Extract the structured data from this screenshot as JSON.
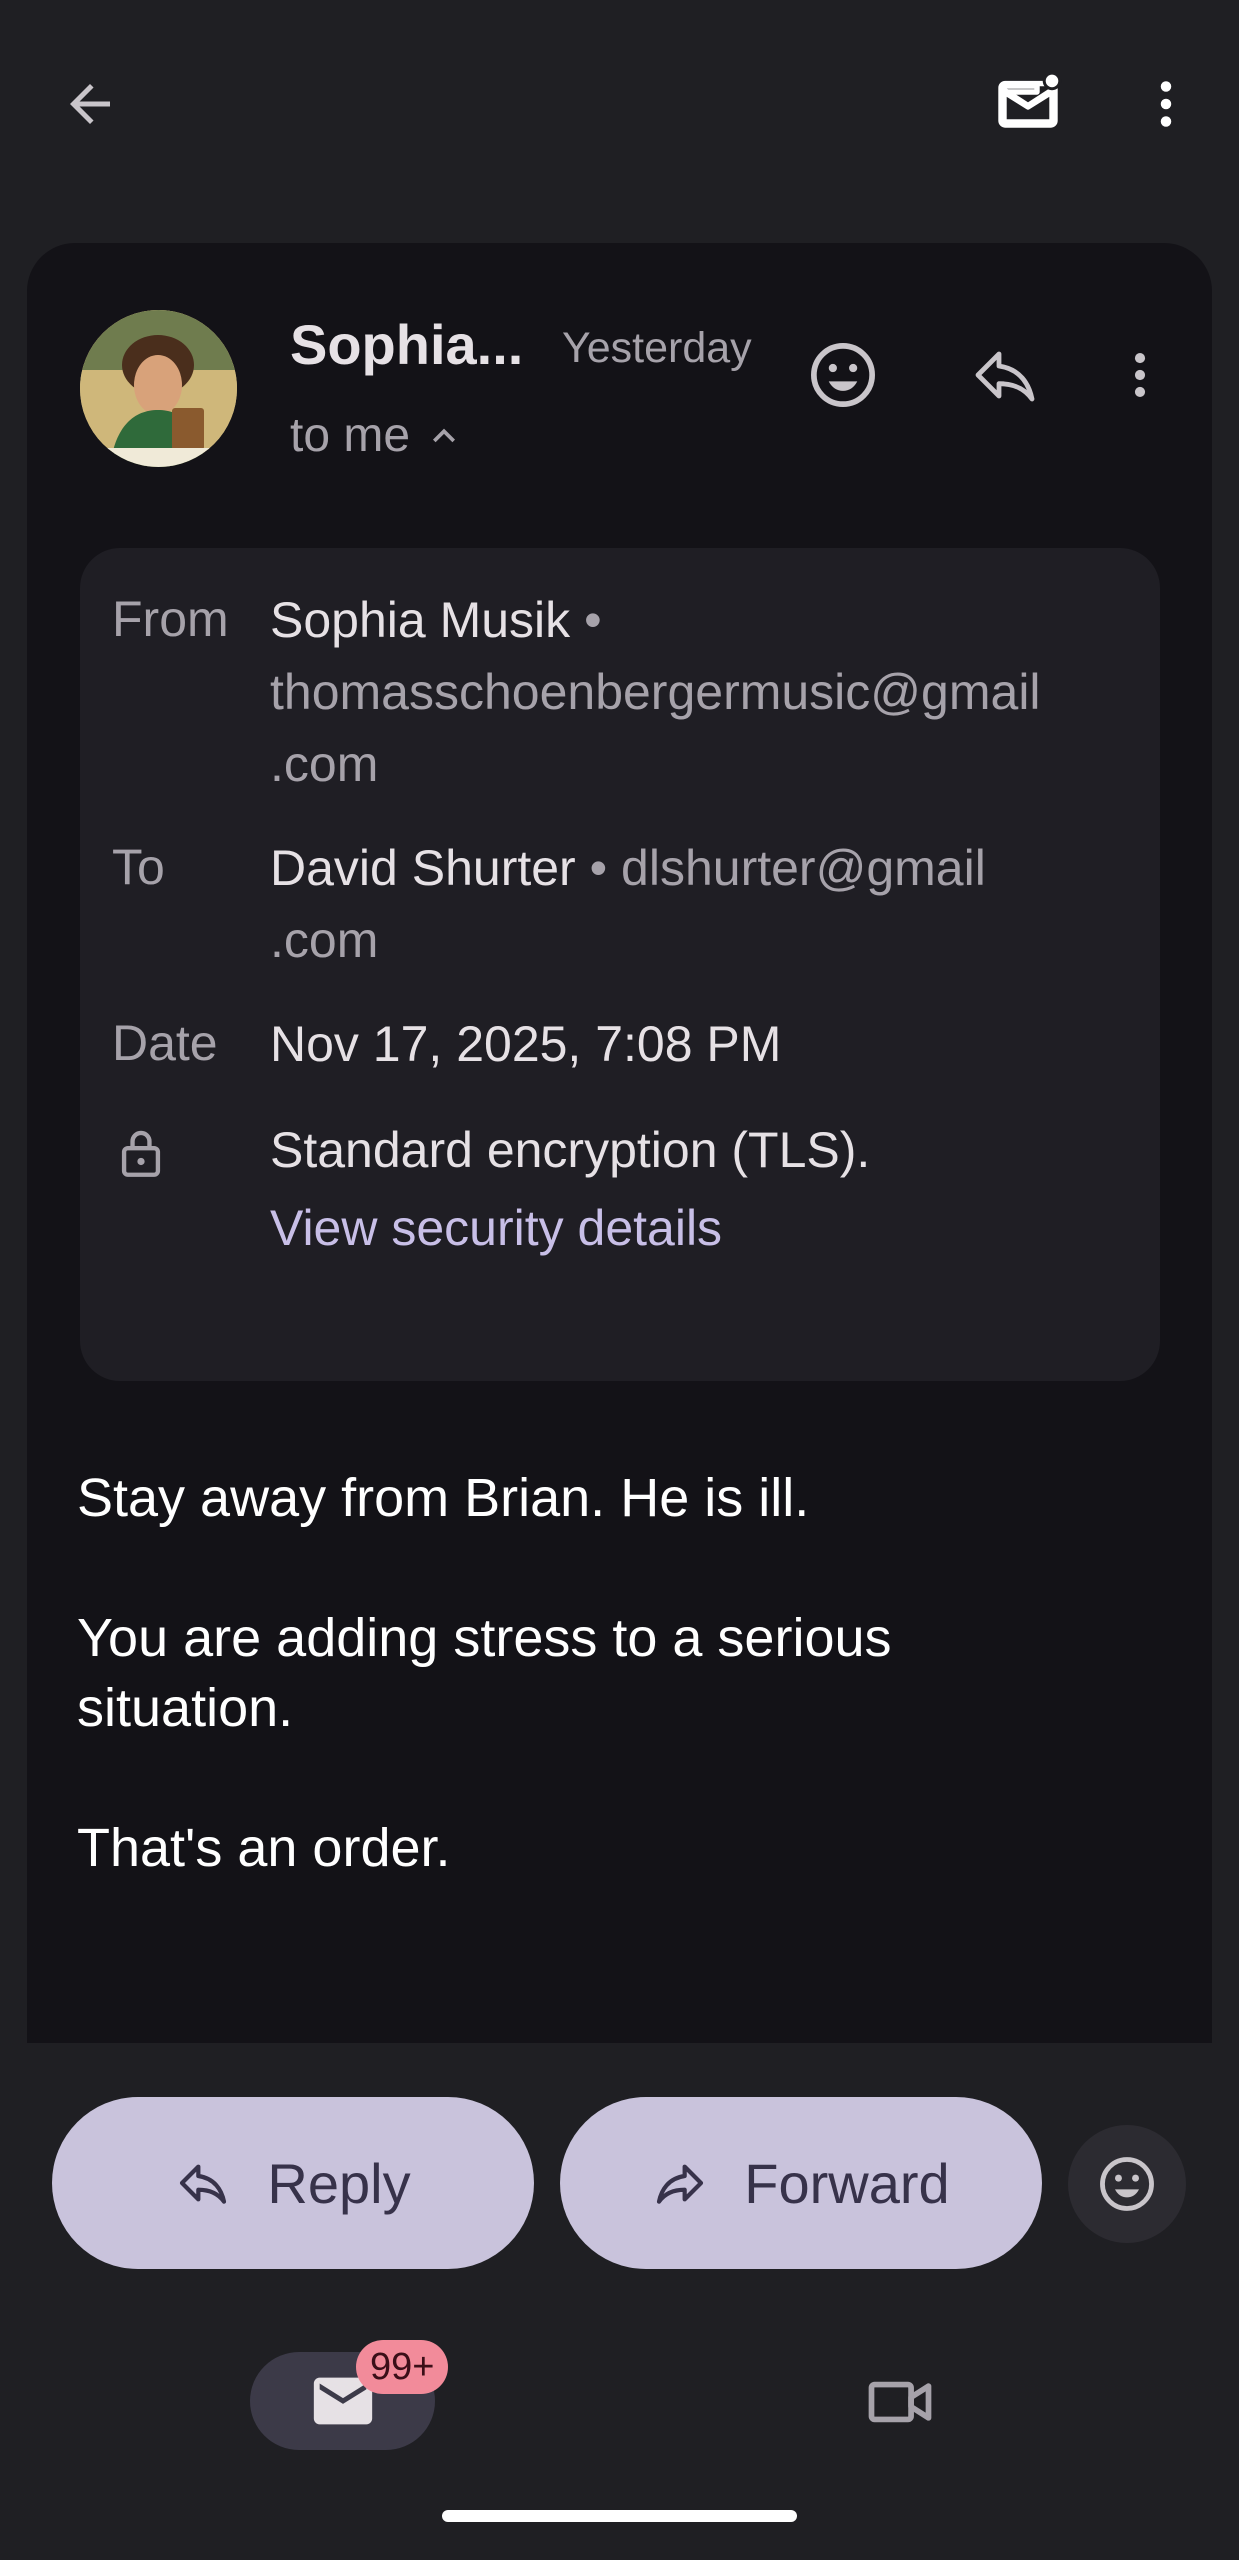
{
  "colors": {
    "background": "#1f1f23",
    "card": "#131217",
    "details_panel": "#1f1e24",
    "pill_button": "#c9c3dc",
    "link": "#c8bfe7",
    "badge": "#f28b9a"
  },
  "header": {
    "sender_short": "Sophia...",
    "time": "Yesterday",
    "recipient_summary": "to me",
    "icons": [
      "arrow-back-icon",
      "mark-unread-icon",
      "more-vert-icon",
      "emoji-icon",
      "reply-icon",
      "chevron-up-icon"
    ]
  },
  "details": {
    "from_label": "From",
    "from_name": "Sophia Musik",
    "from_email_line1": "thomasschoenbergermusic@gmail",
    "from_email_line2": ".com",
    "to_label": "To",
    "to_name": "David Shurter",
    "to_email_line1": "dlshurter@gmail",
    "to_email_line2": ".com",
    "date_label": "Date",
    "date_value": "Nov 17, 2025, 7:08 PM",
    "security_text": "Standard encryption (TLS).",
    "security_link": "View security details",
    "separator": "•"
  },
  "body": {
    "line1": "Stay away from Brian. He is ill.",
    "line2": "You are adding stress to a serious",
    "line3": "situation.",
    "line4": "That's an order."
  },
  "actions": {
    "reply_label": "Reply",
    "forward_label": "Forward"
  },
  "nav": {
    "mail_badge": "99+"
  }
}
